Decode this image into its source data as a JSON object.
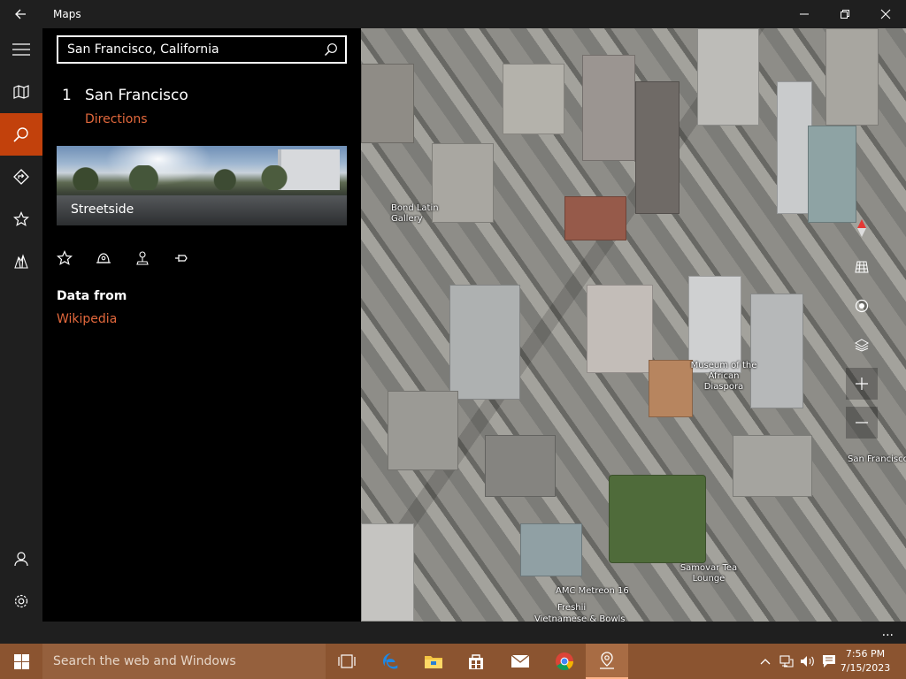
{
  "window": {
    "title": "Maps"
  },
  "rail": {
    "items": [
      {
        "name": "menu-icon"
      },
      {
        "name": "map-icon"
      },
      {
        "name": "search-icon",
        "active": true
      },
      {
        "name": "directions-icon"
      },
      {
        "name": "favorites-icon"
      },
      {
        "name": "3d-cities-icon"
      }
    ],
    "bottom": [
      {
        "name": "account-icon"
      },
      {
        "name": "settings-icon"
      }
    ]
  },
  "search": {
    "value": "San Francisco, California"
  },
  "result": {
    "number": "1",
    "title": "San Francisco",
    "directions_label": "Directions"
  },
  "streetside": {
    "label": "Streetside"
  },
  "actions": [
    "star-icon",
    "nearby-icon",
    "share-icon",
    "pin-icon"
  ],
  "data_from": {
    "label": "Data from",
    "source": "Wikipedia"
  },
  "map": {
    "labels": {
      "bond": "Bond Latin Gallery",
      "museum": "Museum of the African Diaspora",
      "sf": "San Francisco",
      "samovar": "Samovar Tea Lounge",
      "amc": "AMC Metreon 16",
      "freshii": "Freshii",
      "vietnamese": "Vietnamese & Bowls"
    },
    "controls": [
      "compass-icon",
      "tilt-icon",
      "locate-icon",
      "layers-icon",
      "zoom-in-icon",
      "zoom-out-icon"
    ]
  },
  "appbar": {
    "more": "..."
  },
  "taskbar": {
    "search_placeholder": "Search the web and Windows",
    "time": "7:56 PM",
    "date": "7/15/2023"
  },
  "colors": {
    "accent": "#c2410c",
    "link": "#e2683c",
    "taskbar": "#8b5430"
  }
}
